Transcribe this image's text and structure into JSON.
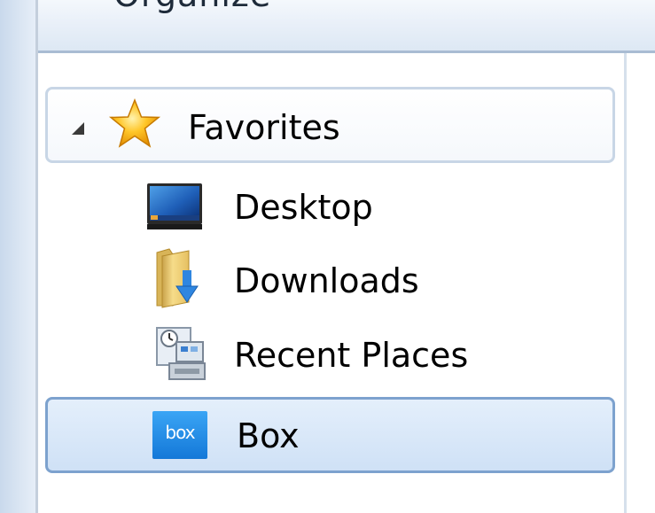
{
  "toolbar": {
    "organize_label": "Organize"
  },
  "nav": {
    "favorites": {
      "label": "Favorites",
      "expanded": true
    },
    "items": [
      {
        "label": "Desktop",
        "icon": "desktop-icon"
      },
      {
        "label": "Downloads",
        "icon": "downloads-folder-icon"
      },
      {
        "label": "Recent Places",
        "icon": "recent-places-icon"
      },
      {
        "label": "Box",
        "icon": "box-icon",
        "icon_text": "box",
        "selected": true
      }
    ]
  },
  "colors": {
    "selection_border": "#7da2ce",
    "selection_fill": "#d6e6f8",
    "box_brand": "#1f8ee8",
    "star": "#f5b820"
  }
}
